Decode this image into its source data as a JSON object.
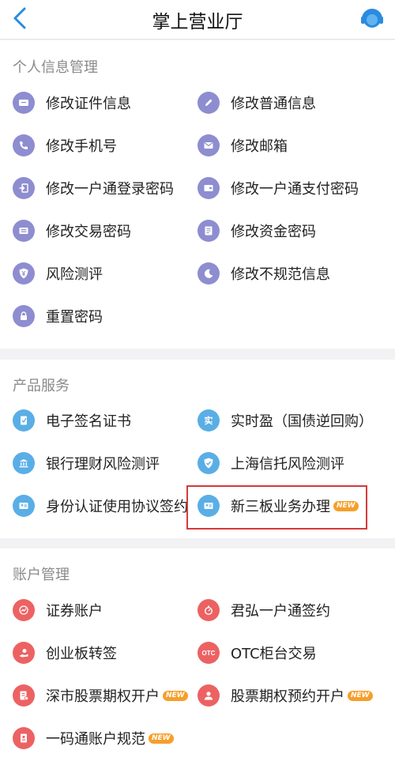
{
  "header": {
    "title": "掌上营业厅"
  },
  "sections": {
    "personal": {
      "title": "个人信息管理",
      "items": [
        "修改证件信息",
        "修改普通信息",
        "修改手机号",
        "修改邮箱",
        "修改一户通登录密码",
        "修改一户通支付密码",
        "修改交易密码",
        "修改资金密码",
        "风险测评",
        "修改不规范信息",
        "重置密码"
      ]
    },
    "product": {
      "title": "产品服务",
      "items": [
        "电子签名证书",
        "实时盈（国债逆回购）",
        "银行理财风险测评",
        "上海信托风险测评",
        "身份认证使用协议签约",
        "新三板业务办理"
      ]
    },
    "account": {
      "title": "账户管理",
      "items": [
        "证券账户",
        "君弘一户通签约",
        "创业板转签",
        "OTC柜台交易",
        "深市股票期权开户",
        "股票期权预约开户",
        "一码通账户规范"
      ]
    }
  },
  "badges": {
    "new": "NEW"
  },
  "icons": {
    "id-card": "实",
    "otc": "OTC",
    "yen": "¥"
  },
  "colors": {
    "personal": "#8e8dd0",
    "product": "#5aaee6",
    "account": "#ec6263",
    "highlight": "#d53a3a",
    "badge": "#f59f2a"
  }
}
